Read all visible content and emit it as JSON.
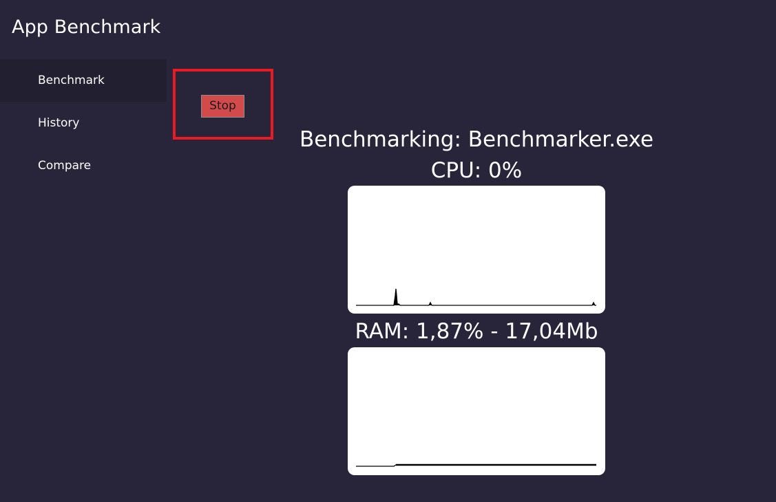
{
  "app": {
    "title": "App Benchmark"
  },
  "sidebar": {
    "items": [
      {
        "label": "Benchmark",
        "active": true
      },
      {
        "label": "History",
        "active": false
      },
      {
        "label": "Compare",
        "active": false
      }
    ]
  },
  "controls": {
    "stop_label": "Stop"
  },
  "benchmark": {
    "title": "Benchmarking: Benchmarker.exe",
    "cpu_label": "CPU: 0%",
    "ram_label": "RAM: 1,87% - 17,04Mb"
  },
  "colors": {
    "background": "#28253a",
    "sidebar_active": "#221f31",
    "stop_button": "#d24a4a",
    "highlight_border": "#e81a24",
    "graph_background": "#ffffff",
    "graph_line": "#000000"
  }
}
